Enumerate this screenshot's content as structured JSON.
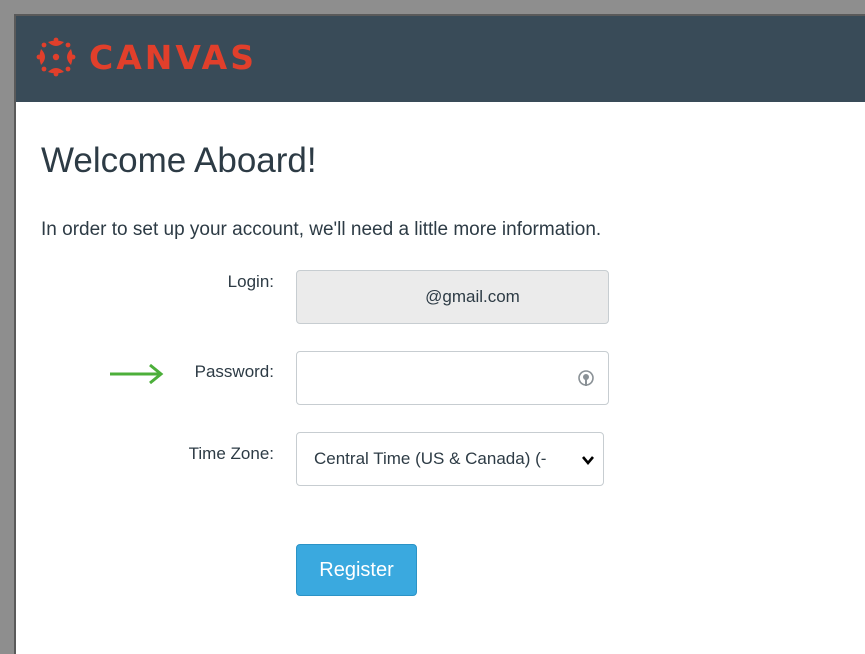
{
  "header": {
    "brand_name": "CANVAS",
    "brand_color": "#e13f2b",
    "background_color": "#394b58",
    "logo_icon": "canvas-logo-icon"
  },
  "page": {
    "title": "Welcome Aboard!",
    "intro": "In order to set up your account, we'll need a little more information."
  },
  "form": {
    "login": {
      "label": "Login:",
      "value": "@gmail.com"
    },
    "password": {
      "label": "Password:",
      "value": "",
      "icon": "password-manager-key-icon"
    },
    "timezone": {
      "label": "Time Zone:",
      "selected": "Central Time (US & Canada) (-"
    },
    "register_label": "Register",
    "register_color": "#3aa9df"
  },
  "annotation": {
    "arrow_icon": "green-arrow-icon",
    "arrow_color": "#4caf3a"
  }
}
